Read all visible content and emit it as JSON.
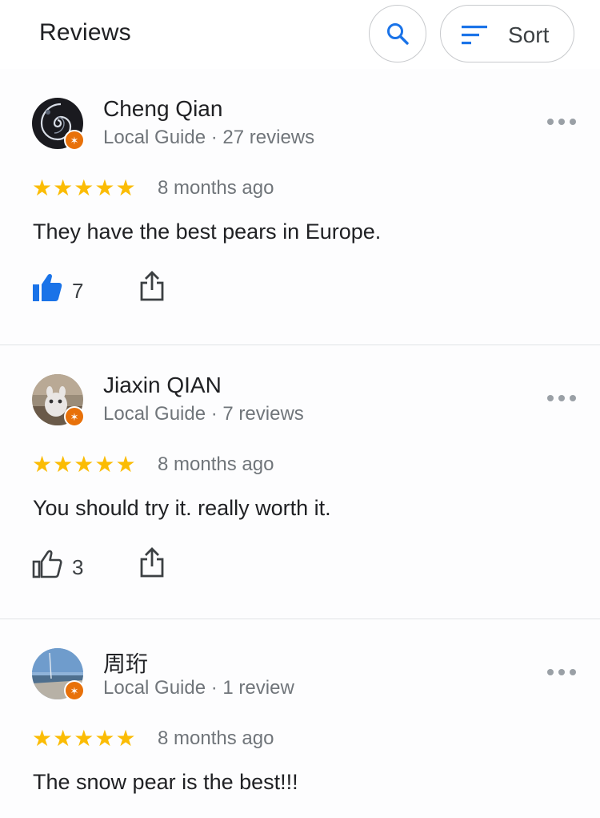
{
  "header": {
    "title": "Reviews",
    "search_icon": "search-icon",
    "sort_icon": "sort-icon",
    "sort_label": "Sort"
  },
  "colors": {
    "accent_blue": "#1a73e8",
    "star_yellow": "#fbbc04",
    "local_guide_badge": "#e8710a",
    "secondary_text": "#70757a"
  },
  "reviews": [
    {
      "author": "Cheng Qian",
      "meta": "Local Guide · 27 reviews",
      "rating": 5,
      "date": "8 months ago",
      "text": "They have the best pears in Europe.",
      "likes": "7",
      "liked": true
    },
    {
      "author": "Jiaxin QIAN",
      "meta": "Local Guide · 7 reviews",
      "rating": 5,
      "date": "8 months ago",
      "text": "You should try it. really worth it.",
      "likes": "3",
      "liked": false
    },
    {
      "author": "周珩",
      "meta": "Local Guide · 1 review",
      "rating": 5,
      "date": "8 months ago",
      "text": "The snow pear is the best!!!"
    }
  ]
}
